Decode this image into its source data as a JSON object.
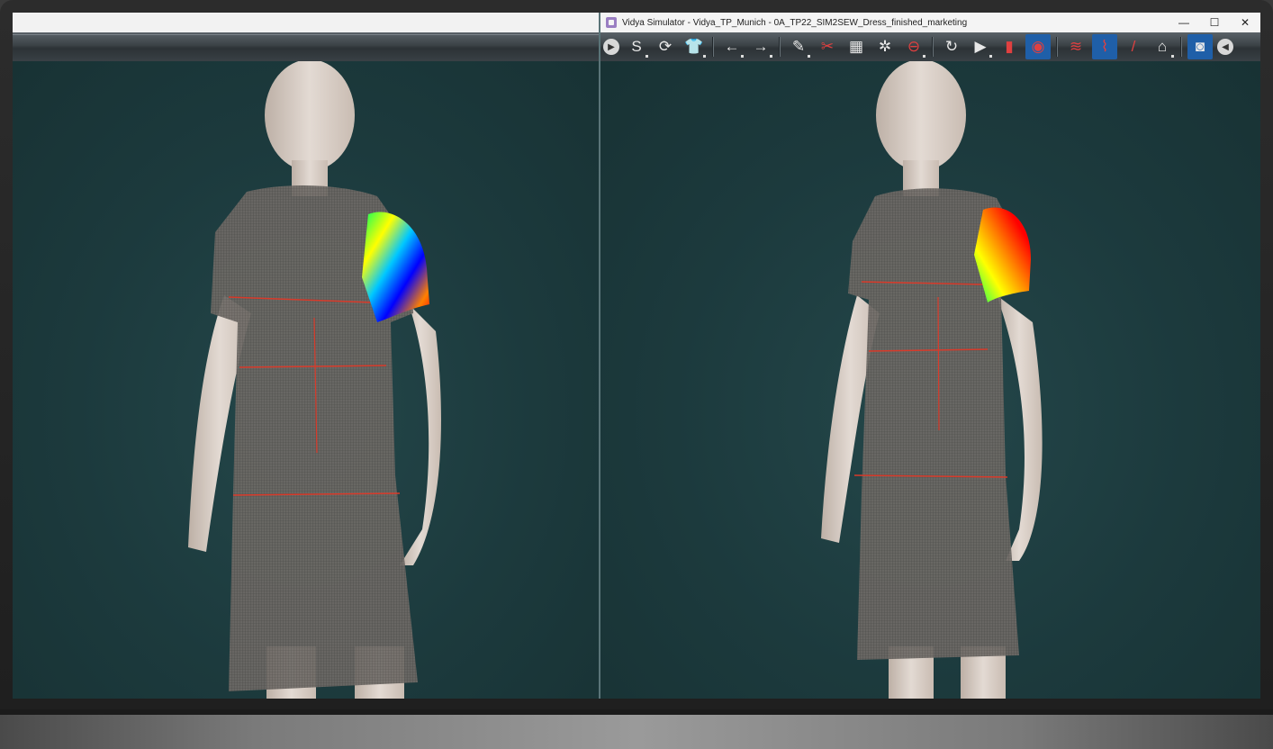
{
  "window": {
    "title": "Vidya Simulator - Vidya_TP_Munich - 0A_TP22_SIM2SEW_Dress_finished_marketing",
    "minimize": "—",
    "maximize": "☐",
    "close": "✕"
  },
  "toolbar": {
    "items": [
      {
        "icon": "expand-left-icon",
        "glyph": "▶"
      },
      {
        "icon": "simulate-icon",
        "glyph": "S"
      },
      {
        "icon": "reset-icon",
        "glyph": "⟳"
      },
      {
        "icon": "garment-icon",
        "glyph": "👕"
      },
      {
        "icon": "undo-icon",
        "glyph": "←"
      },
      {
        "icon": "redo-icon",
        "glyph": "→"
      },
      {
        "icon": "pin-icon",
        "glyph": "✎"
      },
      {
        "icon": "sewing-icon",
        "glyph": "✂"
      },
      {
        "icon": "pattern-icon",
        "glyph": "▦"
      },
      {
        "icon": "explode-icon",
        "glyph": "✲"
      },
      {
        "icon": "cut-icon",
        "glyph": "⊖"
      },
      {
        "icon": "refresh-icon",
        "glyph": "↻"
      },
      {
        "icon": "play-icon",
        "glyph": "▶"
      },
      {
        "icon": "fabric-icon",
        "glyph": "▮"
      },
      {
        "icon": "strain-map-icon",
        "glyph": "◉"
      },
      {
        "icon": "measure-icon",
        "glyph": "≋"
      },
      {
        "icon": "tape-icon",
        "glyph": "⌇"
      },
      {
        "icon": "pen-icon",
        "glyph": "/"
      },
      {
        "icon": "iron-icon",
        "glyph": "⌂"
      },
      {
        "icon": "camera-icon",
        "glyph": "◙"
      },
      {
        "icon": "collapse-right-icon",
        "glyph": "◀"
      }
    ]
  },
  "colors": {
    "viewport_bg": "#1d3a3c",
    "heatmap": [
      "#0000ff",
      "#00c8ff",
      "#00ff60",
      "#ffff00",
      "#ff8000",
      "#ff0000"
    ],
    "seam_line": "#d83a2a"
  }
}
